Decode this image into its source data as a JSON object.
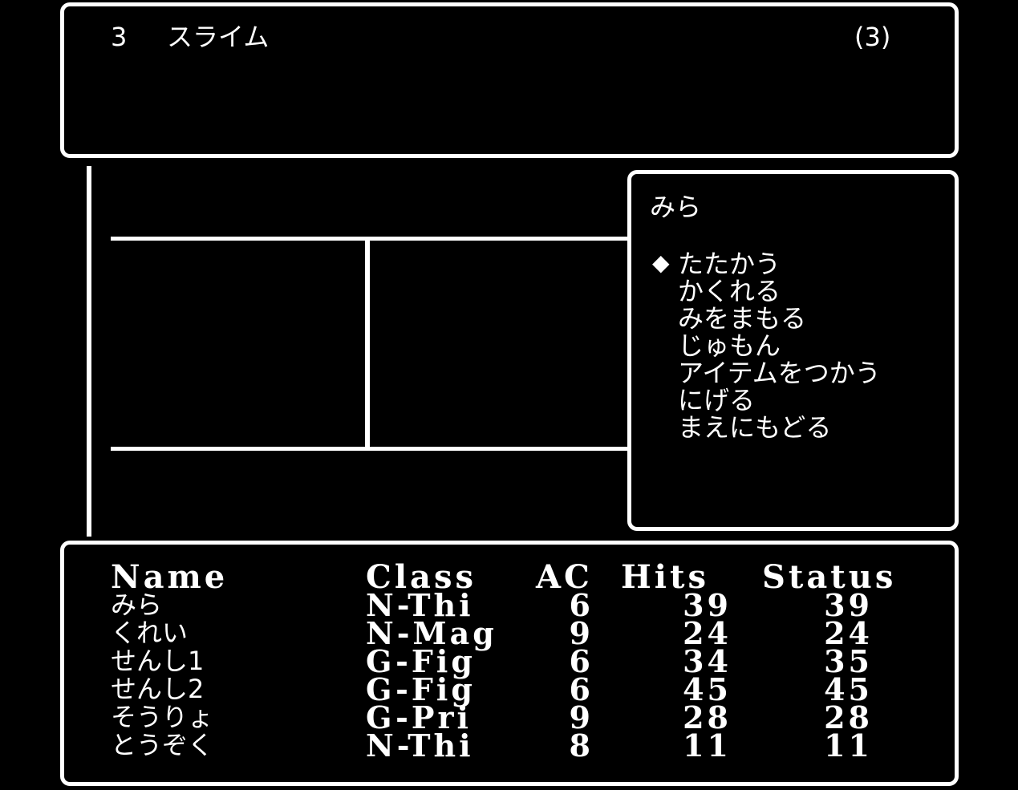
{
  "encounter": {
    "group_number": "3",
    "monster_name": "スライム",
    "count": "(3)"
  },
  "command_menu": {
    "character_name": "みら",
    "cursor": "◆",
    "options": [
      "たたかう",
      "かくれる",
      "みをまもる",
      "じゅもん",
      "アイテムをつかう",
      "にげる",
      "まえにもどる"
    ],
    "selected_index": 0
  },
  "party": {
    "headers": {
      "name": "Name",
      "class": "Class",
      "ac": "AC",
      "hits": "Hits",
      "status": "Status"
    },
    "members": [
      {
        "name": "みら",
        "class": "N-Thi",
        "ac": "6",
        "hits": "39",
        "status": "39"
      },
      {
        "name": "くれい",
        "class": "N-Mag",
        "ac": "9",
        "hits": "24",
        "status": "24"
      },
      {
        "name": "せんし1",
        "class": "G-Fig",
        "ac": "6",
        "hits": "34",
        "status": "35"
      },
      {
        "name": "せんし2",
        "class": "G-Fig",
        "ac": "6",
        "hits": "45",
        "status": "45"
      },
      {
        "name": "そうりょ",
        "class": "G-Pri",
        "ac": "9",
        "hits": "28",
        "status": "28"
      },
      {
        "name": "とうぞく",
        "class": "N-Thi",
        "ac": "8",
        "hits": "11",
        "status": "11"
      }
    ]
  },
  "colors": {
    "background": "#000000",
    "foreground": "#ffffff"
  }
}
